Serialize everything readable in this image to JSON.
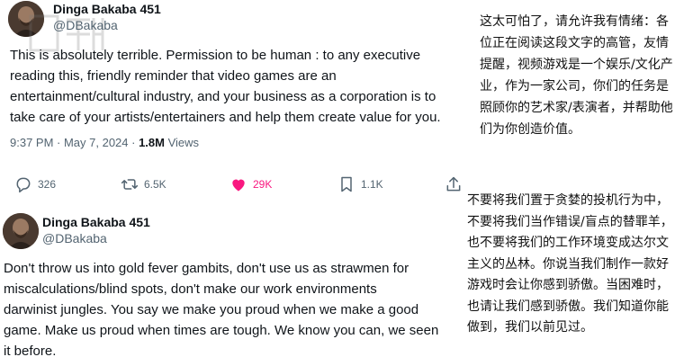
{
  "tweets": [
    {
      "author_name": "Dinga Bakaba 451",
      "handle": "@DBakaba",
      "lines": [
        "This is absolutely terrible. Permission to be human : to any executive",
        "reading this, friendly reminder that video games are an",
        "entertainment/cultural industry, and your business as a corporation is to",
        "take care of your artists/entertainers and help them create value for you."
      ],
      "timestamp": "9:37 PM · May 7, 2024 ·",
      "views_count": "1.8M",
      "views_label": "Views",
      "actions": {
        "replies": "326",
        "reposts": "6.5K",
        "likes": "29K",
        "bookmarks": "1.1K"
      }
    },
    {
      "author_name": "Dinga Bakaba 451",
      "handle": "@DBakaba",
      "lines": [
        "Don't throw us into gold fever gambits, don't use us as strawmen for",
        "miscalculations/blind spots, don't make our work environments",
        "darwinist jungles. You say we make you proud when we make a good",
        "game. Make us proud when times are tough. We know you can, we seen",
        "it before."
      ]
    }
  ],
  "translation": {
    "block1": [
      "这太可怕了，请允许我有情绪：各",
      "位正在阅读这段文字的高管，友情",
      "提醒，视频游戏是一个娱乐/文化产",
      "业，作为一家公司，你们的任务是",
      "照顾你的艺术家/表演者，并帮助他",
      "们为你创造价值。"
    ],
    "block2": [
      "不要将我们置于贪婪的投机行为中，",
      "不要将我们当作错误/盲点的替罪羊，",
      "也不要将我们的工作环境变成达尔文",
      "主义的丛林。你说当我们制作一款好",
      "游戏时会让你感到骄傲。当困难时，",
      "也请让我们感到骄傲。我们知道你能",
      "做到，我们以前见过。"
    ]
  },
  "colors": {
    "text": "#0f1419",
    "secondary": "#536471",
    "like": "#f91880"
  },
  "icons": [
    "reply-icon",
    "repost-icon",
    "like-icon",
    "bookmark-icon",
    "share-icon"
  ]
}
